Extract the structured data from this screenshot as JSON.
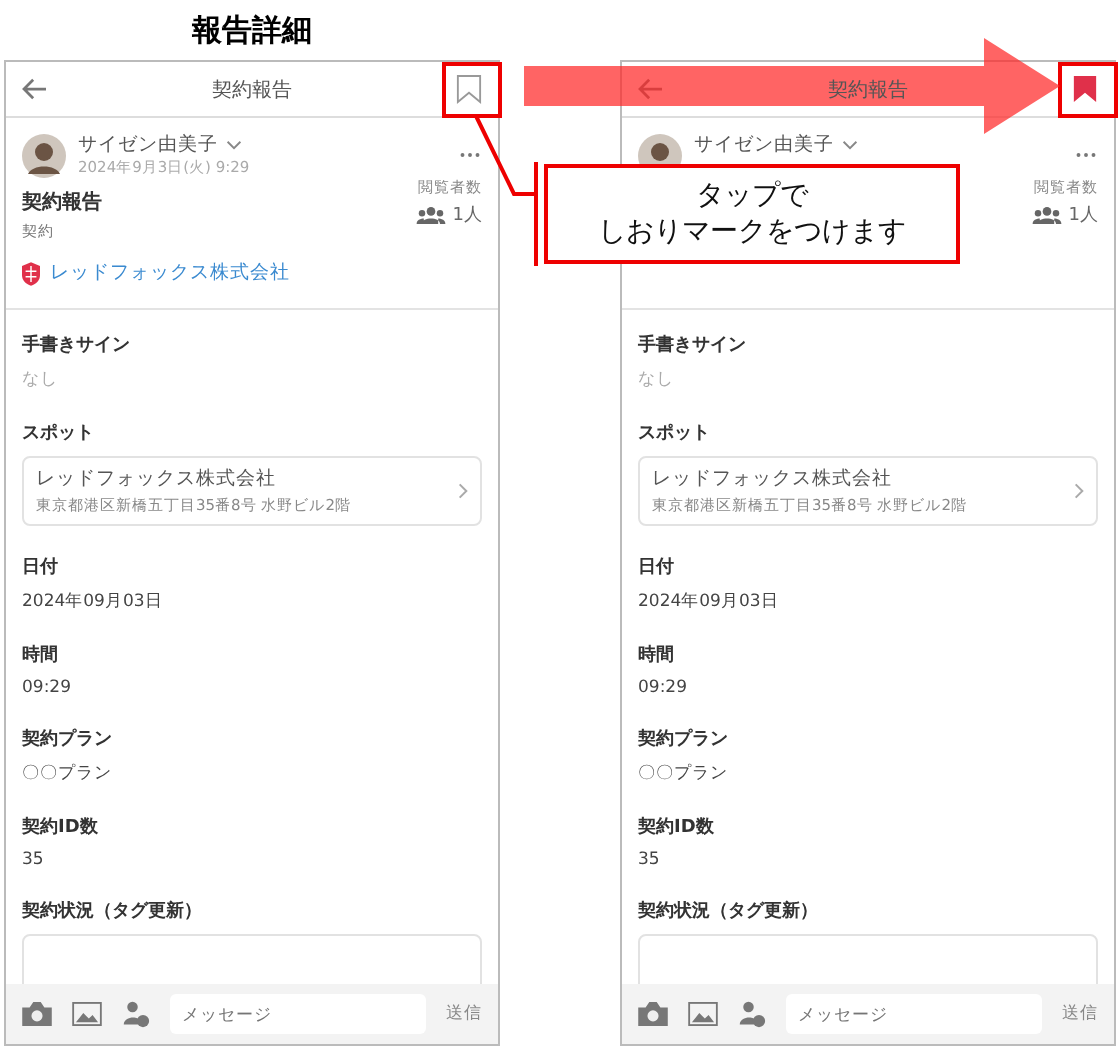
{
  "page_title": "報告詳細",
  "phones": [
    {
      "header": {
        "title": "契約報告",
        "bookmarked": false
      },
      "author": {
        "name": "サイゼン由美子",
        "date": "2024年9月3日(火) 9:29"
      },
      "viewers": {
        "label": "閲覧者数",
        "count": "1人"
      },
      "report": {
        "title": "契約報告",
        "type": "契約",
        "company": "レッドフォックス株式会社"
      },
      "sections": [
        {
          "kind": "muted",
          "label": "手書きサイン",
          "value": "なし"
        },
        {
          "kind": "card",
          "label": "スポット",
          "name": "レッドフォックス株式会社",
          "address": "東京都港区新橋五丁目35番8号 水野ビル2階"
        },
        {
          "kind": "text",
          "label": "日付",
          "value": "2024年09月03日"
        },
        {
          "kind": "text",
          "label": "時間",
          "value": "09:29"
        },
        {
          "kind": "text",
          "label": "契約プラン",
          "value": "〇〇プラン"
        },
        {
          "kind": "text",
          "label": "契約ID数",
          "value": "35"
        },
        {
          "kind": "tags",
          "label": "契約状況（タグ更新）"
        }
      ],
      "composer": {
        "placeholder": "メッセージ",
        "send": "送信"
      }
    },
    {
      "header": {
        "title": "契約報告",
        "bookmarked": true
      },
      "author": {
        "name": "サイゼン由美子"
      },
      "viewers": {
        "label": "閲覧者数",
        "count": "1人"
      },
      "sections": [
        {
          "kind": "muted",
          "label": "手書きサイン",
          "value": "なし"
        },
        {
          "kind": "card",
          "label": "スポット",
          "name": "レッドフォックス株式会社",
          "address": "東京都港区新橋五丁目35番8号 水野ビル2階"
        },
        {
          "kind": "text",
          "label": "日付",
          "value": "2024年09月03日"
        },
        {
          "kind": "text",
          "label": "時間",
          "value": "09:29"
        },
        {
          "kind": "text",
          "label": "契約プラン",
          "value": "〇〇プラン"
        },
        {
          "kind": "text",
          "label": "契約ID数",
          "value": "35"
        },
        {
          "kind": "tags",
          "label": "契約状況（タグ更新）"
        }
      ],
      "composer": {
        "placeholder": "メッセージ",
        "send": "送信"
      }
    }
  ],
  "callout": {
    "lines": [
      "タップで",
      "しおりマークをつけます"
    ]
  }
}
